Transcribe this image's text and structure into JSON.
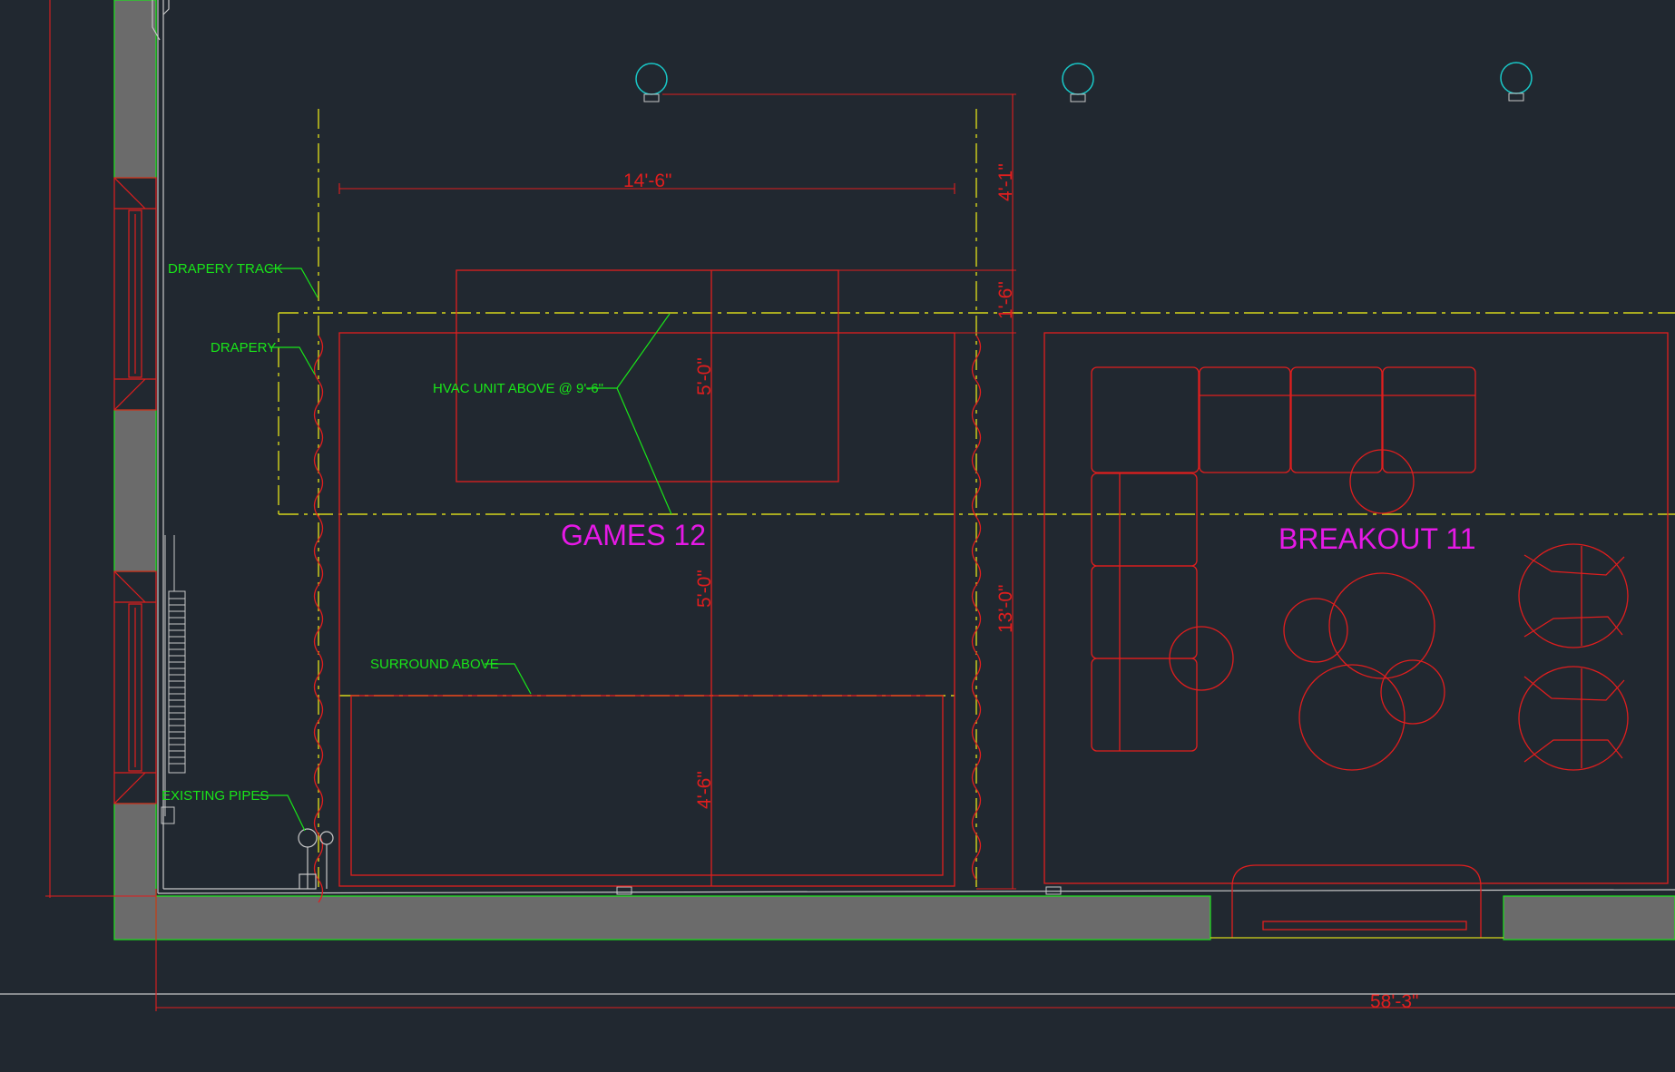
{
  "drawing": {
    "background": "#212830",
    "colors": {
      "furniture": "#e01e1e",
      "notes": "#19e619",
      "rooms": "#e619e6",
      "hidden_lines": "#d6d61a",
      "fixtures": "#19c8c8",
      "wall_fill": "#6b6b6b",
      "wall_edge": "#19e619",
      "outline": "#c8c8c8"
    },
    "rooms": {
      "games": "GAMES 12",
      "breakout": "BREAKOUT 11"
    },
    "notes": {
      "drapery_track": "DRAPERY TRACK",
      "drapery": "DRAPERY",
      "hvac": "HVAC UNIT ABOVE @ 9'-6\"",
      "surround": "SURROUND ABOVE",
      "pipes": "EXISTING PIPES"
    },
    "dimensions": {
      "games_width": "14'-6\"",
      "top_offset": "4'-1\"",
      "track_offset": "1'-6\"",
      "room_depth": "13'-0\"",
      "hvac_depth": "5'-0\"",
      "mid_depth": "5'-0\"",
      "stage_depth": "4'-6\"",
      "overall": "58'-3\""
    },
    "icons": {
      "ceiling_fixture": "ceiling-light-icon",
      "radiator": "radiator-icon",
      "pipe": "pipe-icon"
    }
  }
}
